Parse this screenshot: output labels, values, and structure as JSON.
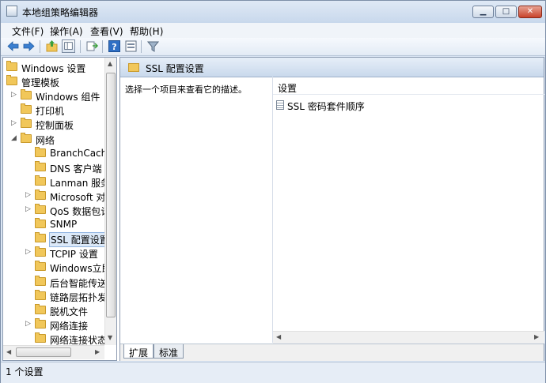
{
  "window": {
    "title": "本地组策略编辑器"
  },
  "menu": [
    "文件(F)",
    "操作(A)",
    "查看(V)",
    "帮助(H)"
  ],
  "tree": [
    {
      "label": "Windows 设置",
      "indent": 0,
      "exp": ""
    },
    {
      "label": "管理模板",
      "indent": 0,
      "exp": "◢"
    },
    {
      "label": "Windows 组件",
      "indent": 1,
      "exp": "▷"
    },
    {
      "label": "打印机",
      "indent": 1,
      "exp": ""
    },
    {
      "label": "控制面板",
      "indent": 1,
      "exp": "▷"
    },
    {
      "label": "网络",
      "indent": 1,
      "exp": "◢"
    },
    {
      "label": "BranchCache",
      "indent": 2,
      "exp": ""
    },
    {
      "label": "DNS 客户端",
      "indent": 2,
      "exp": ""
    },
    {
      "label": "Lanman 服务器",
      "indent": 2,
      "exp": ""
    },
    {
      "label": "Microsoft 对等",
      "indent": 2,
      "exp": "▷"
    },
    {
      "label": "QoS 数据包计",
      "indent": 2,
      "exp": "▷"
    },
    {
      "label": "SNMP",
      "indent": 2,
      "exp": ""
    },
    {
      "label": "SSL 配置设置",
      "indent": 2,
      "exp": "",
      "selected": true
    },
    {
      "label": "TCPIP 设置",
      "indent": 2,
      "exp": "▷"
    },
    {
      "label": "Windows立即",
      "indent": 2,
      "exp": ""
    },
    {
      "label": "后台智能传送",
      "indent": 2,
      "exp": ""
    },
    {
      "label": "链路层拓扑发现",
      "indent": 2,
      "exp": ""
    },
    {
      "label": "脱机文件",
      "indent": 2,
      "exp": ""
    },
    {
      "label": "网络连接",
      "indent": 2,
      "exp": "▷"
    },
    {
      "label": "网络连接状态指示",
      "indent": 2,
      "exp": ""
    }
  ],
  "right": {
    "header": "SSL 配置设置",
    "description": "选择一个项目来查看它的描述。",
    "column": "设置",
    "items": [
      "SSL 密码套件顺序"
    ]
  },
  "tabs": [
    "扩展",
    "标准"
  ],
  "status": "1 个设置"
}
